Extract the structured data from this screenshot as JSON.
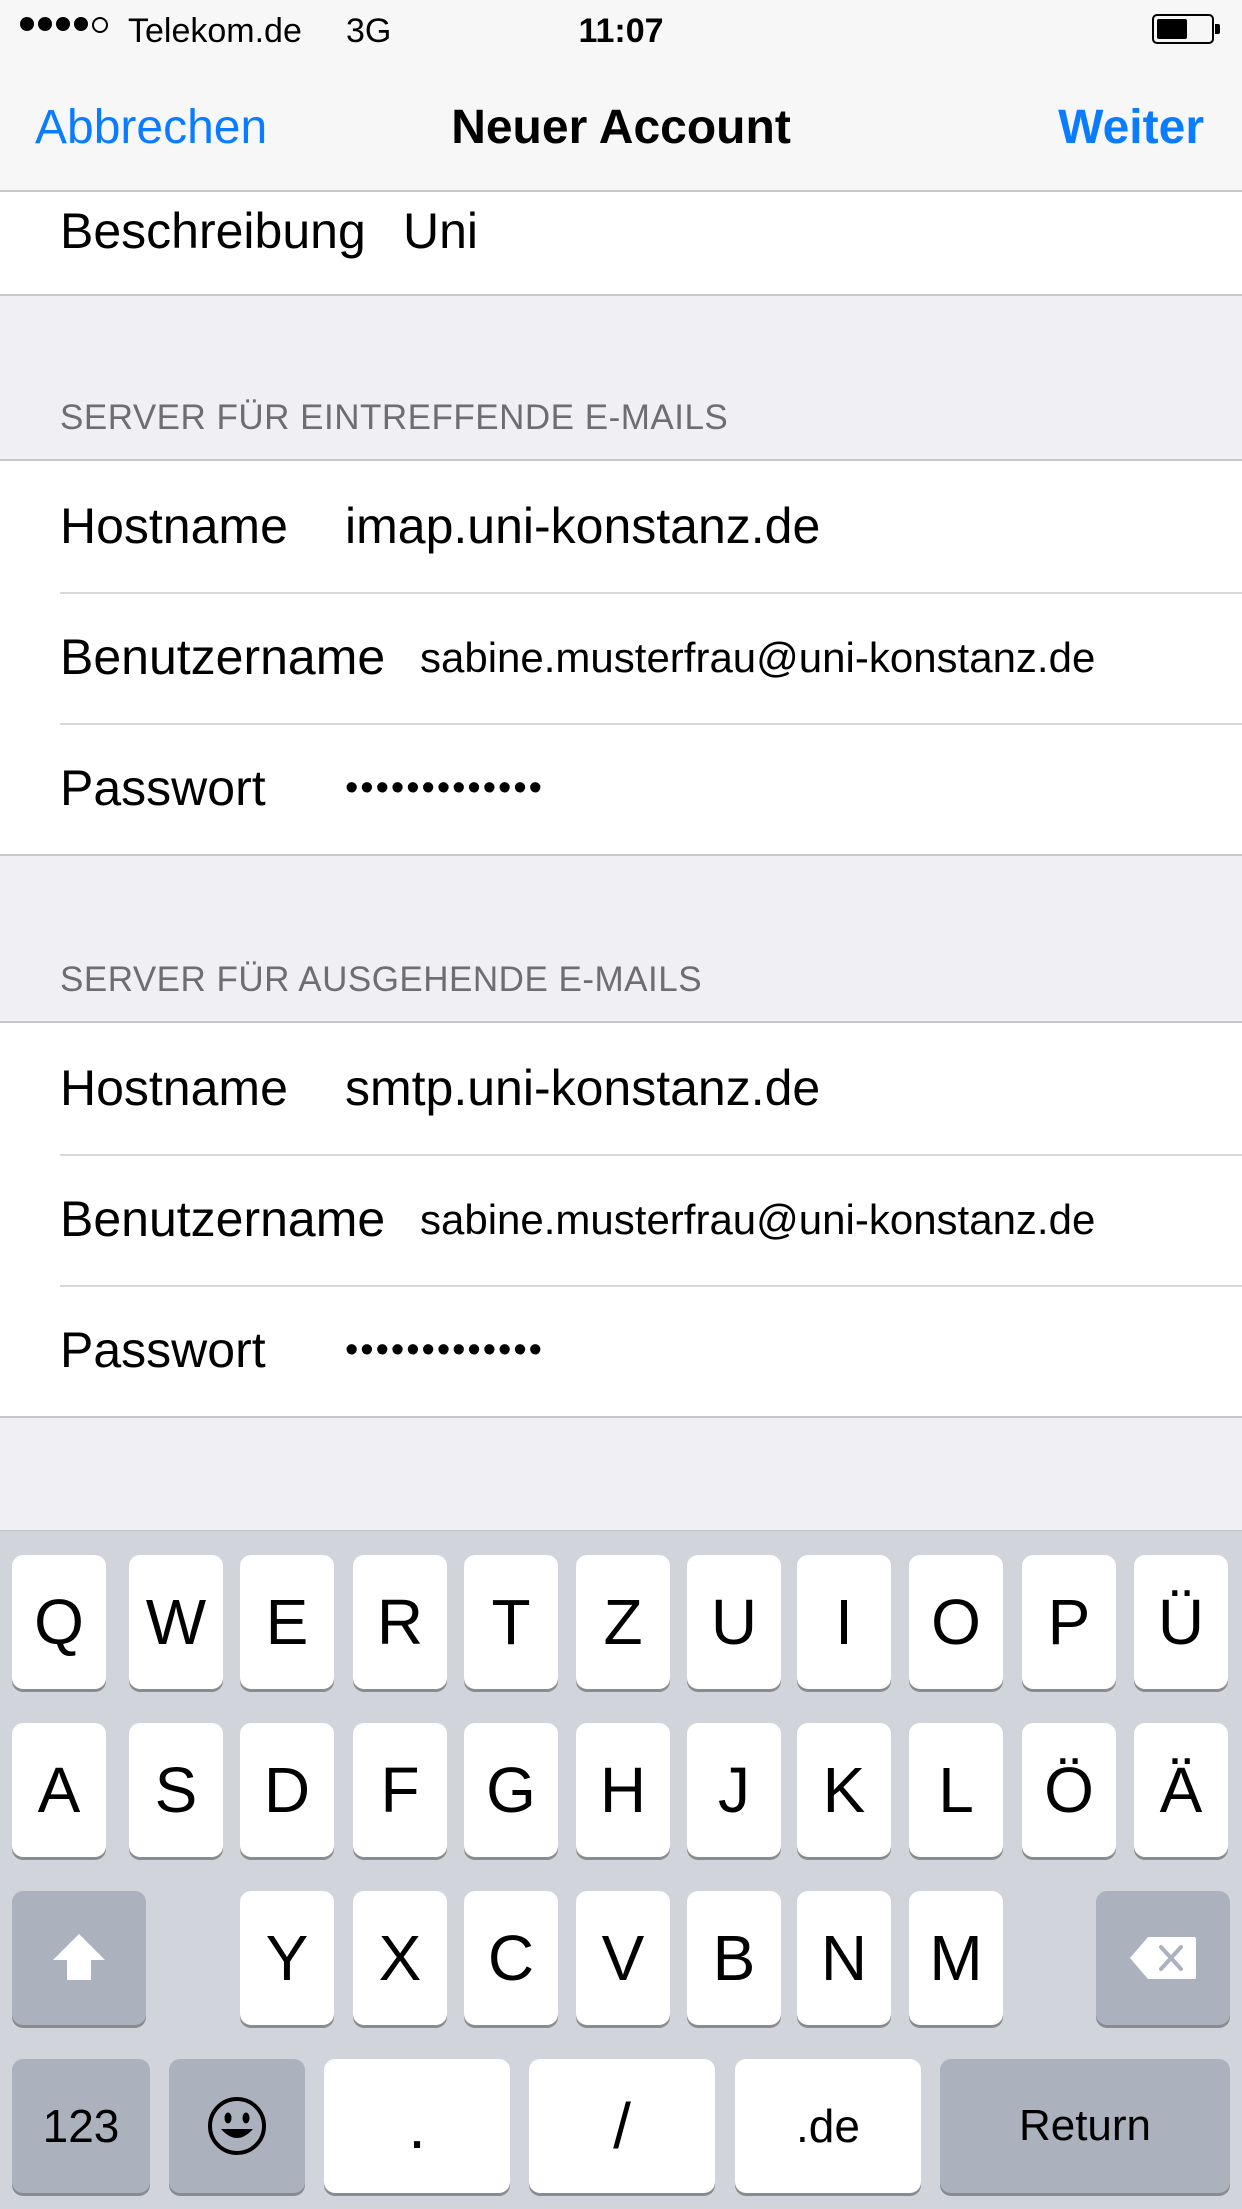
{
  "status_bar": {
    "carrier": "Telekom.de",
    "network": "3G",
    "time": "11:07",
    "signal_bars_filled": 4,
    "signal_bars_total": 5
  },
  "nav": {
    "cancel_label": "Abbrechen",
    "title": "Neuer Account",
    "next_label": "Weiter",
    "accent_color": "#0a7cff"
  },
  "account": {
    "description_label": "Beschreibung",
    "description_value": "Uni"
  },
  "incoming": {
    "header": "SERVER FÜR EINTREFFENDE E-MAILS",
    "hostname_label": "Hostname",
    "hostname_value": "imap.uni-konstanz.de",
    "username_label": "Benutzername",
    "username_value": "sabine.musterfrau@uni-konstanz.de",
    "password_label": "Passwort",
    "password_value": "•••••••••••••"
  },
  "outgoing": {
    "header": "SERVER FÜR AUSGEHENDE E-MAILS",
    "hostname_label": "Hostname",
    "hostname_value": "smtp.uni-konstanz.de",
    "username_label": "Benutzername",
    "username_value": "sabine.musterfrau@uni-konstanz.de",
    "password_label": "Passwort",
    "password_value": "•••••••••••••"
  },
  "keyboard": {
    "row1": [
      "Q",
      "W",
      "E",
      "R",
      "T",
      "Z",
      "U",
      "I",
      "O",
      "P",
      "Ü"
    ],
    "row2": [
      "A",
      "S",
      "D",
      "F",
      "G",
      "H",
      "J",
      "K",
      "L",
      "Ö",
      "Ä"
    ],
    "row3": [
      "Y",
      "X",
      "C",
      "V",
      "B",
      "N",
      "M"
    ],
    "numbers_label": "123",
    "dot_label": ".",
    "slash_label": "/",
    "domain_label": ".de",
    "return_label": "Return",
    "shift_icon": "shift-icon",
    "delete_icon": "delete-icon",
    "emoji_icon": "emoji-icon"
  }
}
